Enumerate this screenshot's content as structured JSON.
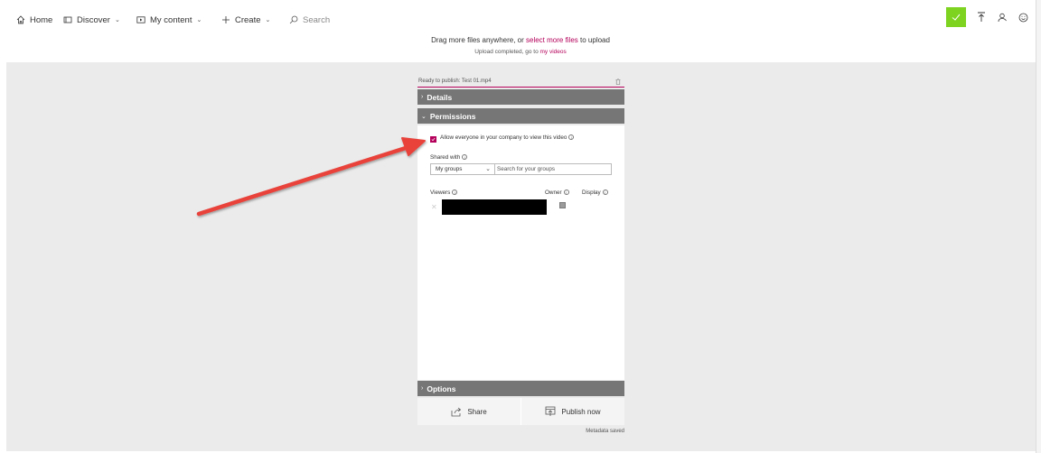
{
  "nav": {
    "home": "Home",
    "discover": "Discover",
    "my_content": "My content",
    "create": "Create",
    "search_placeholder": "Search"
  },
  "upload": {
    "drag_prefix": "Drag more files anywhere, or ",
    "select_link": "select more files",
    "drag_suffix": " to upload",
    "completed_prefix": "Upload completed, go to ",
    "my_videos_link": "my videos"
  },
  "panel": {
    "ready_text": "Ready to publish: Test 01.mp4",
    "details_header": "Details",
    "permissions_header": "Permissions",
    "allow_everyone_label": "Allow everyone in your company to view this video",
    "allow_everyone_checked": true,
    "shared_with_label": "Shared with",
    "groups_select_value": "My groups",
    "groups_search_placeholder": "Search for your groups",
    "viewers_label": "Viewers",
    "owner_label": "Owner",
    "display_label": "Display",
    "options_header": "Options",
    "share_button": "Share",
    "publish_button": "Publish now",
    "metadata_status": "Metadata saved"
  },
  "colors": {
    "accent": "#b4005a",
    "upload_ok": "#7ed321",
    "section_header": "#767676",
    "annotation_arrow": "#e8423a"
  },
  "icons": {
    "home": "home-icon",
    "discover": "discover-icon",
    "my_content": "video-icon",
    "create": "plus-icon",
    "search": "search-icon",
    "upload_status": "checkmark-icon",
    "upload": "upload-icon",
    "profile": "person-icon",
    "feedback": "smiley-icon",
    "trash": "trash-icon",
    "share": "share-icon",
    "publish": "publish-icon"
  }
}
